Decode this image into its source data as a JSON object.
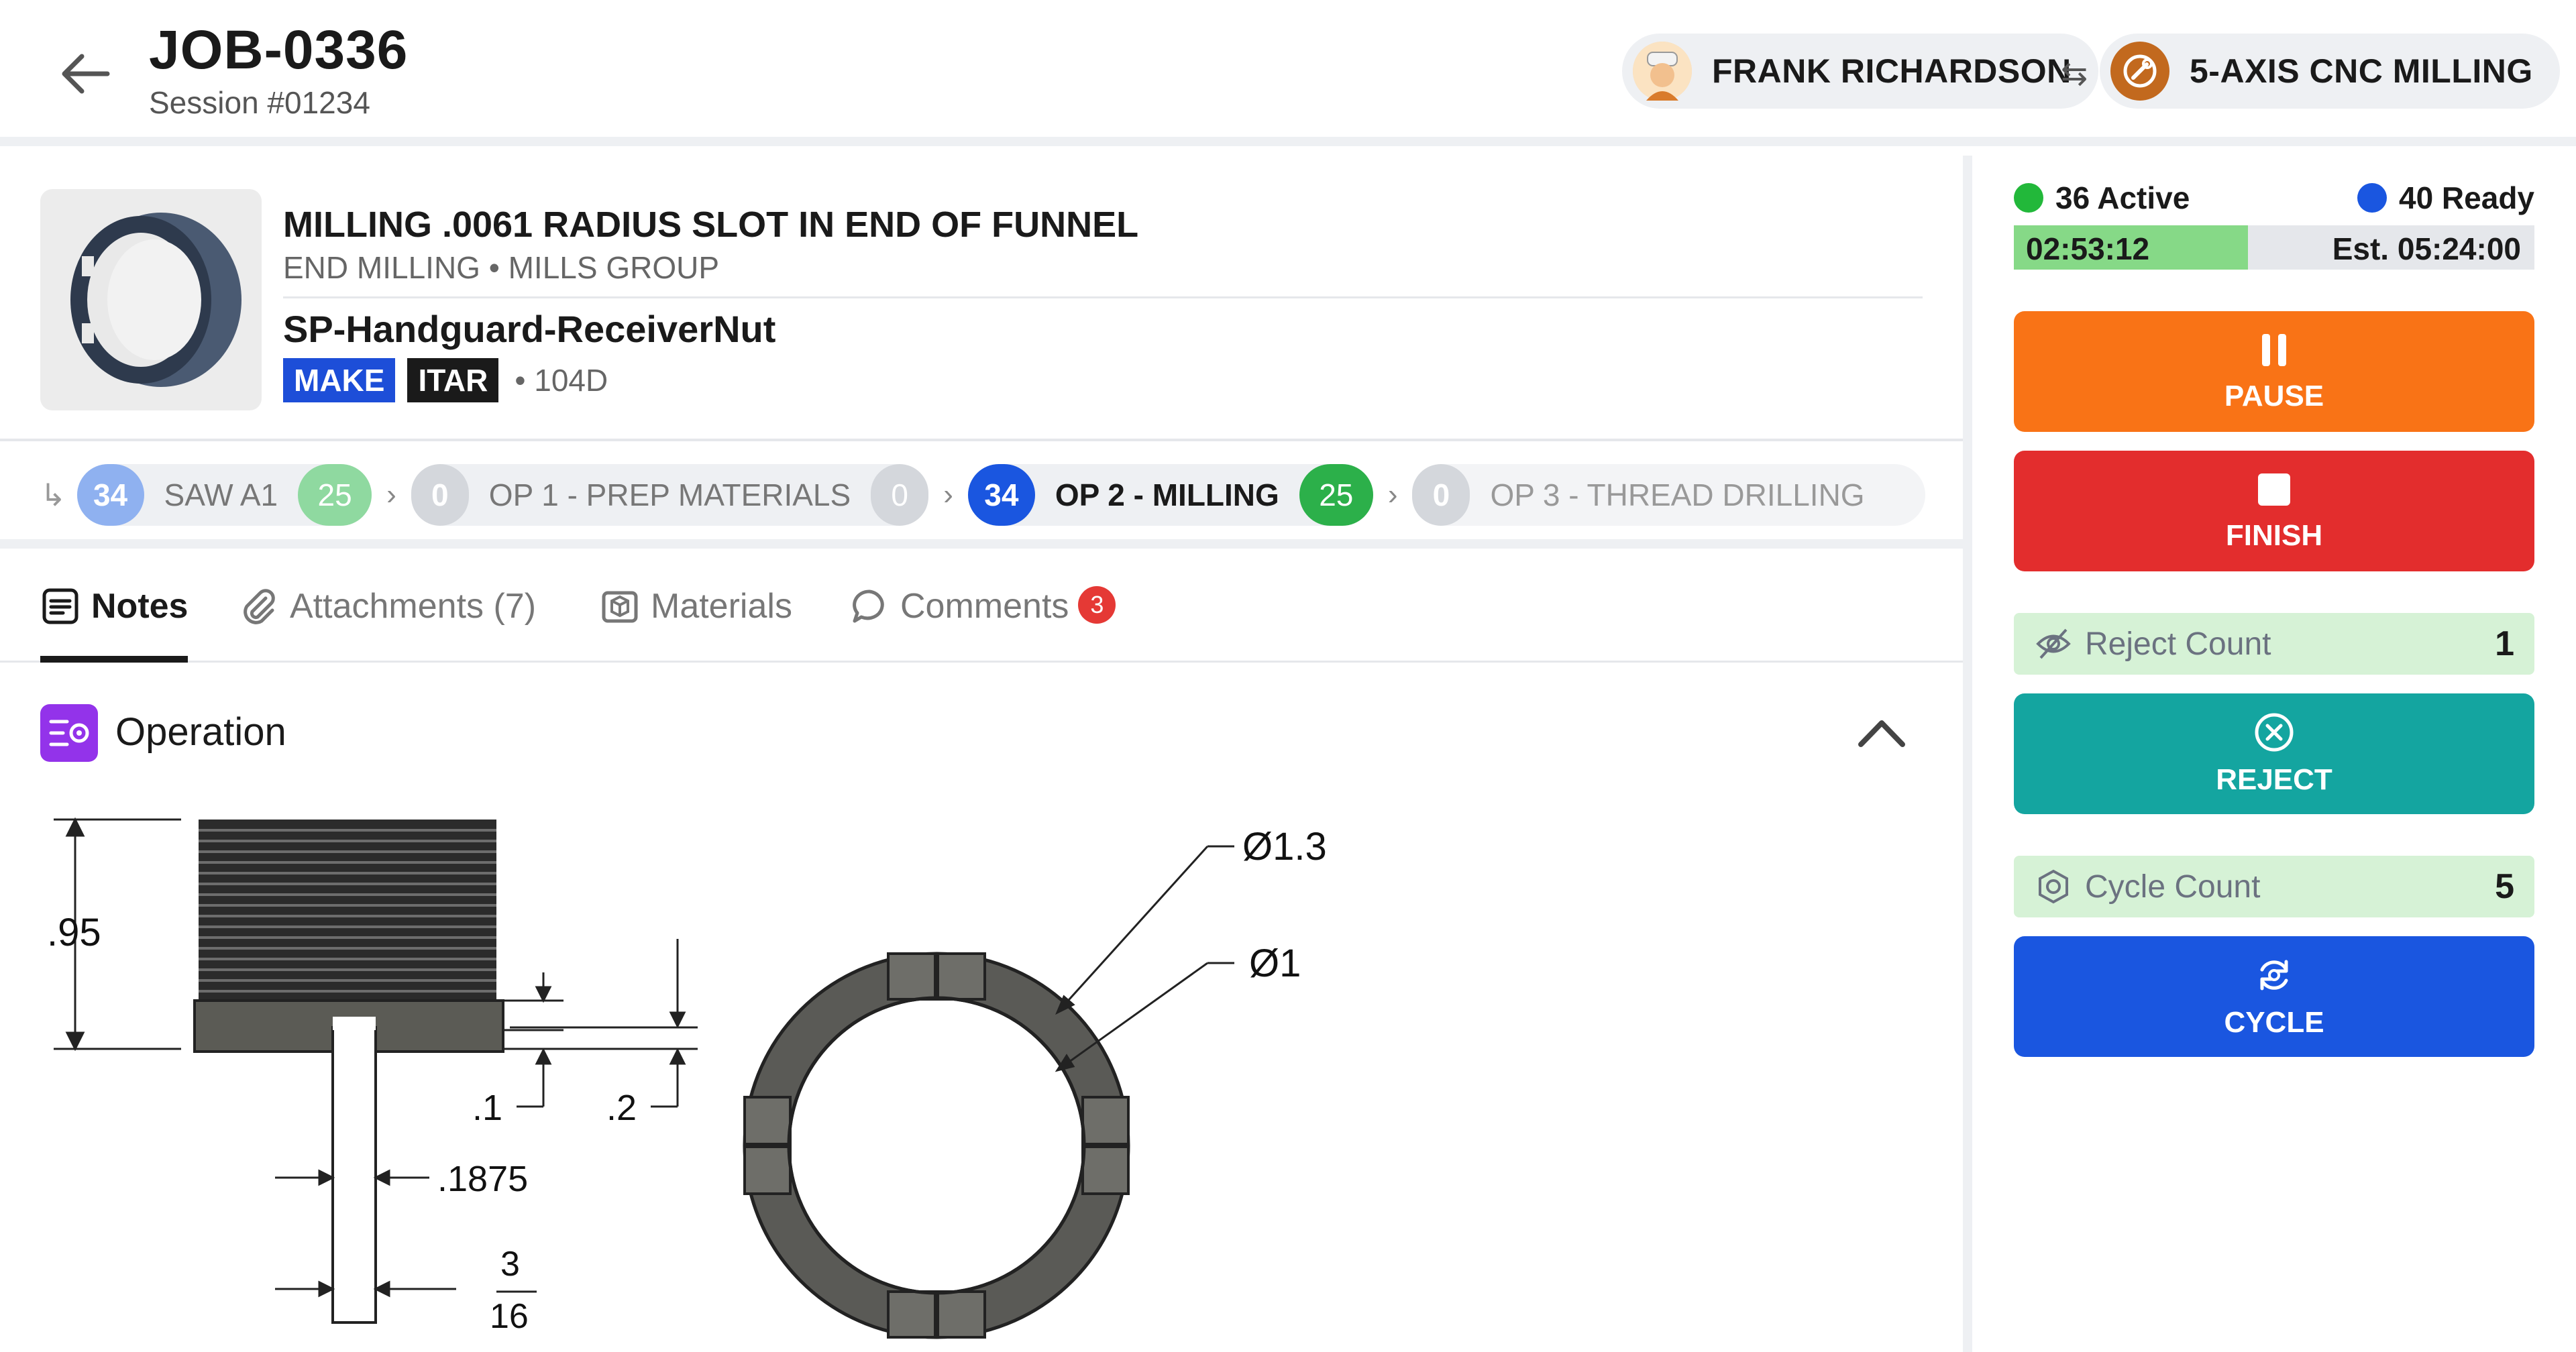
{
  "header": {
    "job_id": "JOB-0336",
    "session": "Session #01234",
    "user_name": "FRANK RICHARDSON",
    "swap_symbol": "⇆",
    "machine_name": "5-AXIS CNC MILLING"
  },
  "job": {
    "operation_title": "MILLING .0061 RADIUS SLOT IN END OF FUNNEL",
    "operation_sub": "END MILLING • MILLS GROUP",
    "part_name": "SP-Handguard-ReceiverNut",
    "tags": [
      "MAKE",
      "ITAR"
    ],
    "meta": "• 104D"
  },
  "operations": [
    {
      "count": "34",
      "name": "SAW A1",
      "done": "25",
      "state": "past"
    },
    {
      "count": "0",
      "name": "OP 1 - PREP MATERIALS",
      "done": "0",
      "state": "past-empty"
    },
    {
      "count": "34",
      "name": "OP 2 - MILLING",
      "done": "25",
      "state": "current"
    },
    {
      "count": "0",
      "name": "OP 3 -  THREAD DRILLING",
      "done": "",
      "state": "future"
    }
  ],
  "tabs": {
    "notes": "Notes",
    "attachments": "Attachments (7)",
    "materials": "Materials",
    "comments": "Comments",
    "comments_badge": "3"
  },
  "section": {
    "title": "Operation"
  },
  "drawing_labels": {
    "height": ".95",
    "flange": ".1",
    "offset": ".2",
    "slot": ".1875",
    "frac_num": "3",
    "frac_den": "16",
    "outer_dia": "Ø1.3",
    "inner_dia": "Ø1"
  },
  "side": {
    "active_label": "36 Active",
    "ready_label": "40 Ready",
    "elapsed": "02:53:12",
    "estimate": "Est. 05:24:00",
    "progress_fraction": 0.45,
    "pause_label": "PAUSE",
    "finish_label": "FINISH",
    "reject_count_label": "Reject Count",
    "reject_count_value": "1",
    "reject_label": "REJECT",
    "cycle_count_label": "Cycle Count",
    "cycle_count_value": "5",
    "cycle_label": "CYCLE"
  },
  "colors": {
    "pause": "#f97316",
    "finish": "#e32d2d",
    "reject": "#14a5a0",
    "cycle": "#1a56e0",
    "active_dot": "#22b83a",
    "ready_dot": "#1a56e0",
    "done_green": "#2cb04a",
    "current_blue": "#1a56e0",
    "past_blue": "#8fb1f0",
    "past_green": "#8fd9a0"
  },
  "icons": {
    "back": "arrow-left-icon",
    "pause": "pause-icon",
    "finish": "stop-icon",
    "reject": "x-circle-icon",
    "cycle": "refresh-icon"
  }
}
